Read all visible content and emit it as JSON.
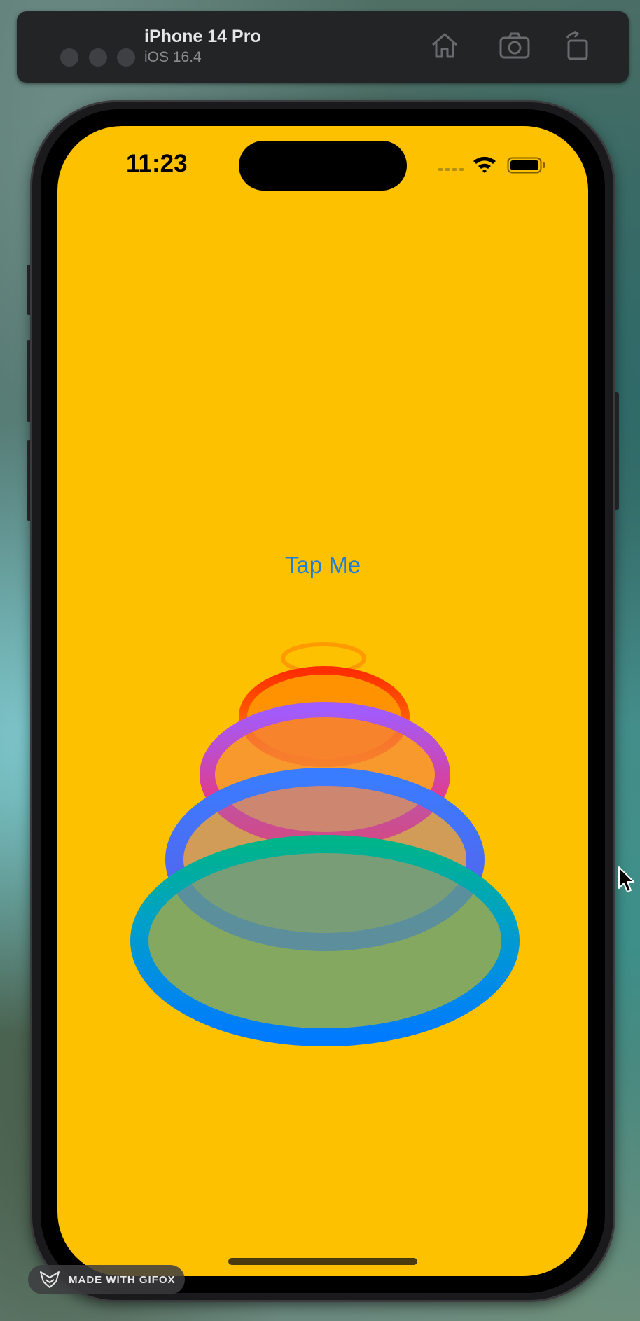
{
  "simulator": {
    "device_name": "iPhone 14 Pro",
    "os_version": "iOS 16.4",
    "icons": [
      "home-icon",
      "screenshot-icon",
      "rotate-icon"
    ]
  },
  "status_bar": {
    "time": "11:23",
    "icons": [
      "cellular-signal-icon",
      "wifi-icon",
      "battery-icon"
    ]
  },
  "app": {
    "background_color": "#fec100",
    "button_label": "Tap Me",
    "button_color": "#1f7fd8",
    "ring_colors": [
      "#ff8a00",
      "#ff2d55",
      "#a05cff",
      "#5e5ce6",
      "#00b4a0",
      "#007aff"
    ]
  },
  "watermark": {
    "label": "MADE WITH GIFOX"
  }
}
